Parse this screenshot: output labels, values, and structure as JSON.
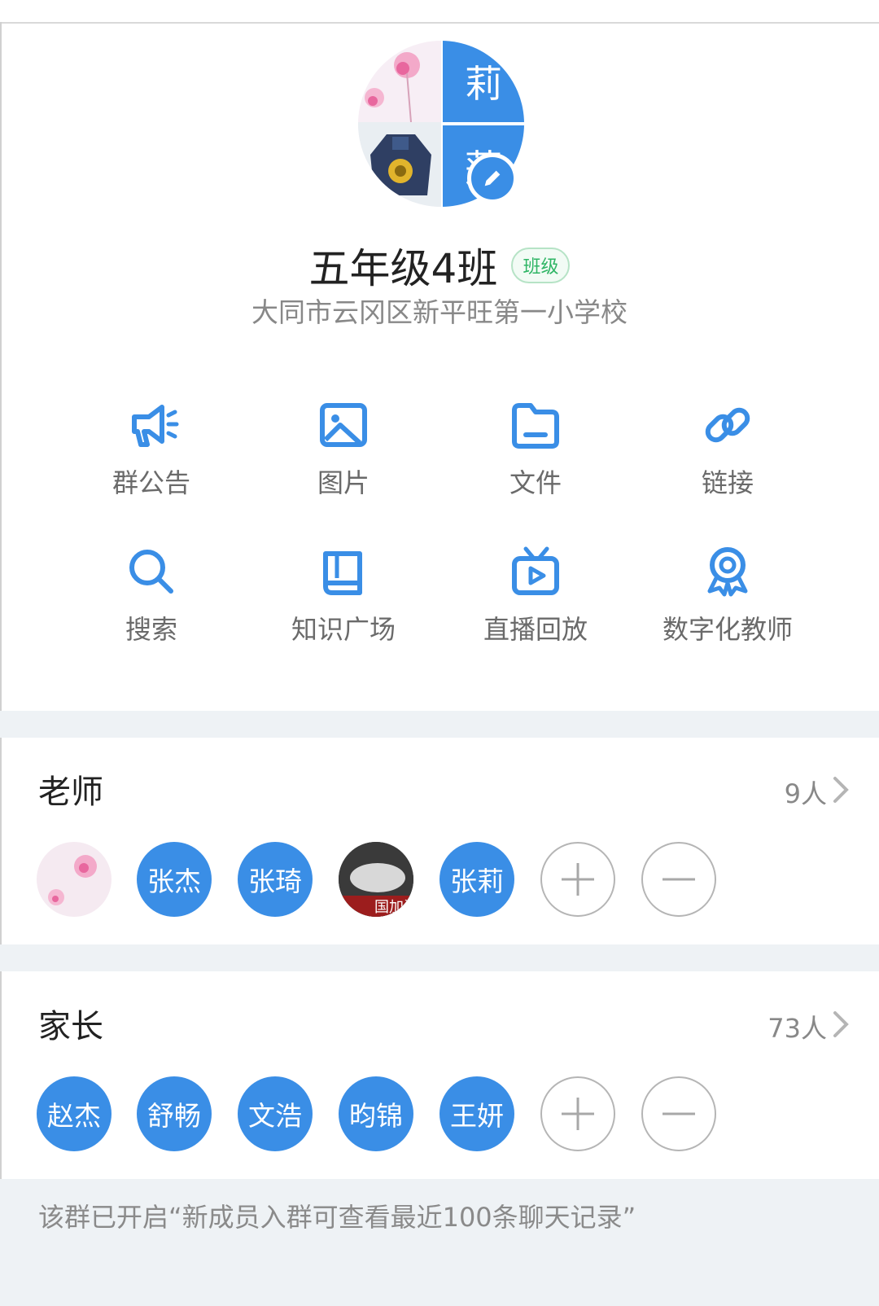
{
  "group": {
    "avatar_chars": [
      "莉",
      "莲"
    ],
    "name": "五年级4班",
    "type_badge": "班级",
    "school": "大同市云冈区新平旺第一小学校"
  },
  "functions": [
    {
      "label": "群公告",
      "icon": "megaphone-icon"
    },
    {
      "label": "图片",
      "icon": "image-icon"
    },
    {
      "label": "文件",
      "icon": "folder-icon"
    },
    {
      "label": "链接",
      "icon": "link-icon"
    },
    {
      "label": "搜索",
      "icon": "search-icon"
    },
    {
      "label": "知识广场",
      "icon": "book-icon"
    },
    {
      "label": "直播回放",
      "icon": "tv-play-icon"
    },
    {
      "label": "数字化教师",
      "icon": "award-icon"
    }
  ],
  "teachers": {
    "title": "老师",
    "count": "9人",
    "members": [
      "",
      "张杰",
      "张琦",
      "",
      "张莉"
    ],
    "photo_caption": "国加油"
  },
  "parents": {
    "title": "家长",
    "count": "73人",
    "members": [
      "赵杰",
      "舒畅",
      "文浩",
      "昀锦",
      "王妍"
    ]
  },
  "notice": "该群已开启“新成员入群可查看最近100条聊天记录”",
  "colors": {
    "accent": "#3a8ee6",
    "badge_green": "#2fb565",
    "background_gap": "#eef2f5"
  }
}
